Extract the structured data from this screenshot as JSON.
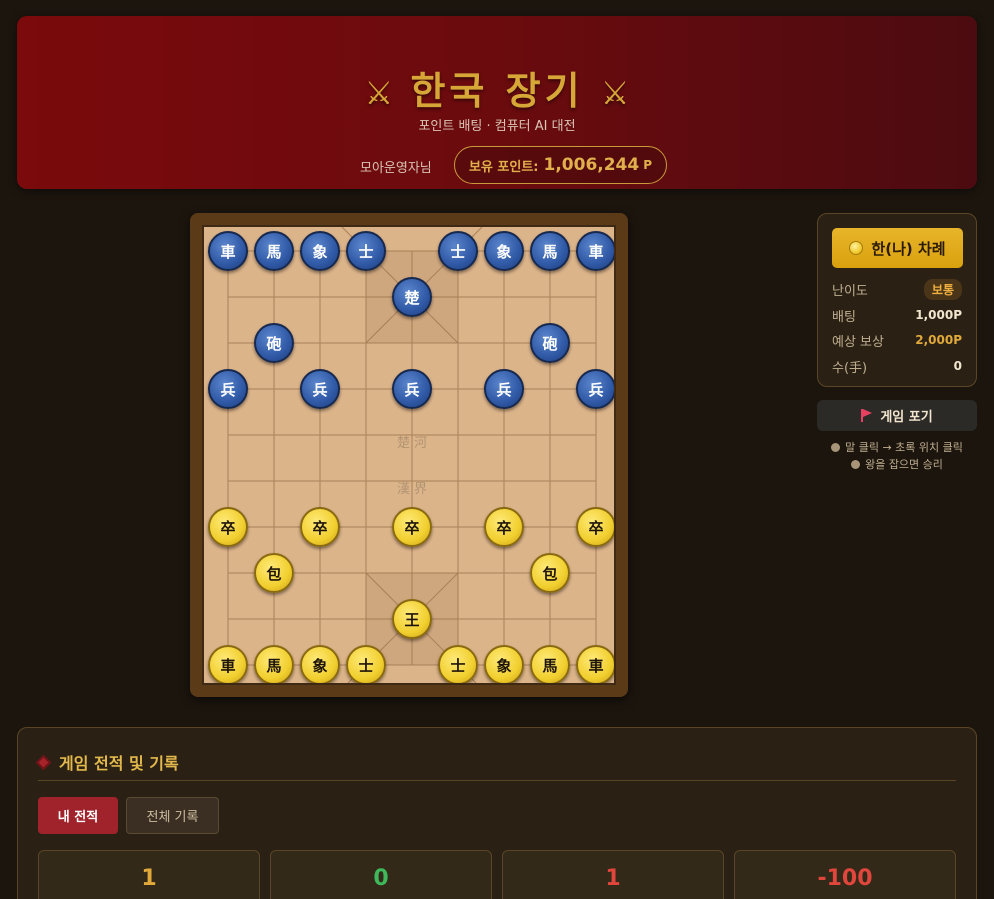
{
  "header": {
    "title": "한국 장기",
    "sword_icon": "⚔",
    "subtitle": "포인트 배팅 · 컴퓨터 AI 대전",
    "user_name": "모아운영자님",
    "points_label": "보유 포인트:",
    "points_value": "1,006,244",
    "points_unit": "P"
  },
  "board": {
    "river_top": "楚河",
    "river_bottom": "漢界",
    "blue_pieces": [
      {
        "label": "車",
        "col": 0,
        "row": 0
      },
      {
        "label": "馬",
        "col": 1,
        "row": 0
      },
      {
        "label": "象",
        "col": 2,
        "row": 0
      },
      {
        "label": "士",
        "col": 3,
        "row": 0
      },
      {
        "label": "士",
        "col": 5,
        "row": 0
      },
      {
        "label": "象",
        "col": 6,
        "row": 0
      },
      {
        "label": "馬",
        "col": 7,
        "row": 0
      },
      {
        "label": "車",
        "col": 8,
        "row": 0
      },
      {
        "label": "楚",
        "col": 4,
        "row": 1
      },
      {
        "label": "砲",
        "col": 1,
        "row": 2
      },
      {
        "label": "砲",
        "col": 7,
        "row": 2
      },
      {
        "label": "兵",
        "col": 0,
        "row": 3
      },
      {
        "label": "兵",
        "col": 2,
        "row": 3
      },
      {
        "label": "兵",
        "col": 4,
        "row": 3
      },
      {
        "label": "兵",
        "col": 6,
        "row": 3
      },
      {
        "label": "兵",
        "col": 8,
        "row": 3
      }
    ],
    "gold_pieces": [
      {
        "label": "卒",
        "col": 0,
        "row": 6
      },
      {
        "label": "卒",
        "col": 2,
        "row": 6
      },
      {
        "label": "卒",
        "col": 4,
        "row": 6
      },
      {
        "label": "卒",
        "col": 6,
        "row": 6
      },
      {
        "label": "卒",
        "col": 8,
        "row": 6
      },
      {
        "label": "包",
        "col": 1,
        "row": 7
      },
      {
        "label": "包",
        "col": 7,
        "row": 7
      },
      {
        "label": "王",
        "col": 4,
        "row": 8
      },
      {
        "label": "車",
        "col": 0,
        "row": 9
      },
      {
        "label": "馬",
        "col": 1,
        "row": 9
      },
      {
        "label": "象",
        "col": 2,
        "row": 9
      },
      {
        "label": "士",
        "col": 3,
        "row": 9
      },
      {
        "label": "士",
        "col": 5,
        "row": 9
      },
      {
        "label": "象",
        "col": 6,
        "row": 9
      },
      {
        "label": "馬",
        "col": 7,
        "row": 9
      },
      {
        "label": "車",
        "col": 8,
        "row": 9
      }
    ]
  },
  "panel": {
    "turn_label": "한(나) 차례",
    "difficulty_label": "난이도",
    "difficulty_value": "보통",
    "bet_label": "배팅",
    "bet_value": "1,000P",
    "reward_label": "예상 보상",
    "reward_value": "2,000P",
    "moves_label": "수(手)",
    "moves_value": "0",
    "forfeit_label": "게임 포기",
    "hint_1": "말 클릭 → 초록 위치 클릭",
    "hint_2": "왕을 잡으면 승리"
  },
  "records": {
    "title": "게임 전적 및 기록",
    "tab_mine": "내 전적",
    "tab_all": "전체 기록",
    "stats": [
      {
        "value": "1",
        "color": "#e0a93a"
      },
      {
        "value": "0",
        "color": "#3fb85c"
      },
      {
        "value": "1",
        "color": "#e0463c"
      },
      {
        "value": "-100",
        "color": "#e0463c"
      }
    ]
  }
}
